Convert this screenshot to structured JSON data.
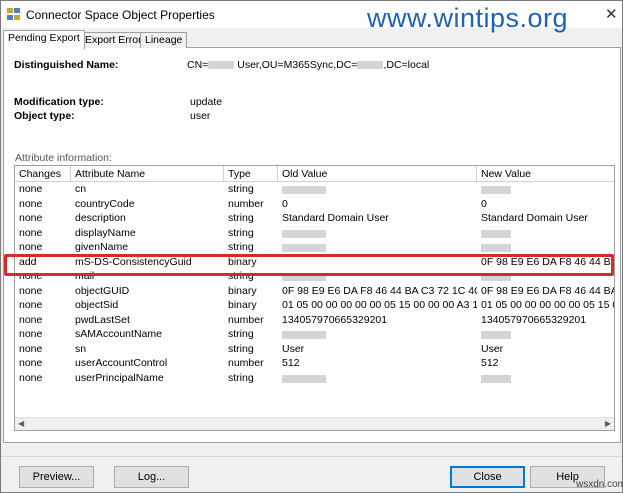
{
  "window": {
    "title": "Connector Space Object Properties",
    "watermark": "www.wintips.org",
    "close_glyph": "✕",
    "footer_mark": "wsxdn.com"
  },
  "tabs": [
    {
      "label": "Pending Export",
      "active": true
    },
    {
      "label": "Export Error",
      "active": false
    },
    {
      "label": "Lineage",
      "active": false
    }
  ],
  "object": {
    "dn_label": "Distinguished Name:",
    "dn_prefix": "CN=",
    "dn_mid": " User,OU=M365Sync,DC=",
    "dn_suffix": ",DC=local",
    "mod_label": "Modification type:",
    "mod_value": "update",
    "type_label": "Object type:",
    "type_value": "user"
  },
  "attributes": {
    "section_label": "Attribute information:",
    "columns": [
      "Changes",
      "Attribute Name",
      "Type",
      "Old Value",
      "New Value"
    ],
    "rows": [
      {
        "change": "none",
        "name": "cn",
        "type": "string",
        "old": "",
        "new": "",
        "old_redacted": true,
        "new_redacted": true
      },
      {
        "change": "none",
        "name": "countryCode",
        "type": "number",
        "old": "0",
        "new": "0"
      },
      {
        "change": "none",
        "name": "description",
        "type": "string",
        "old": "Standard Domain User",
        "new": "Standard Domain User"
      },
      {
        "change": "none",
        "name": "displayName",
        "type": "string",
        "old": "",
        "new": "",
        "old_redacted": true,
        "new_redacted": true
      },
      {
        "change": "none",
        "name": "givenName",
        "type": "string",
        "old": "",
        "new": "",
        "old_redacted": true,
        "new_redacted": true
      },
      {
        "change": "add",
        "name": "mS-DS-ConsistencyGuid",
        "type": "binary",
        "old": "",
        "new": "0F 98 E9 E6 DA F8 46 44 BA C"
      },
      {
        "change": "none",
        "name": "mail",
        "type": "string",
        "old": "",
        "new": "",
        "old_redacted": true,
        "new_redacted": true
      },
      {
        "change": "none",
        "name": "objectGUID",
        "type": "binary",
        "old": "0F 98 E9 E6 DA F8 46 44 BA C3 72 1C 4C...",
        "new": "0F 98 E9 E6 DA F8 46 44 BA C"
      },
      {
        "change": "none",
        "name": "objectSid",
        "type": "binary",
        "old": "01 05 00 00 00 00 00 05 15 00 00 00 A3 1...",
        "new": "01 05 00 00 00 00 00 05 15 00"
      },
      {
        "change": "none",
        "name": "pwdLastSet",
        "type": "number",
        "old": "134057970665329201",
        "new": "134057970665329201"
      },
      {
        "change": "none",
        "name": "sAMAccountName",
        "type": "string",
        "old": "",
        "new": "",
        "old_redacted": true,
        "new_redacted": true
      },
      {
        "change": "none",
        "name": "sn",
        "type": "string",
        "old": "User",
        "new": "User"
      },
      {
        "change": "none",
        "name": "userAccountControl",
        "type": "number",
        "old": "512",
        "new": "512"
      },
      {
        "change": "none",
        "name": "userPrincipalName",
        "type": "string",
        "old": "",
        "new": "",
        "old_redacted": true,
        "new_redacted": true
      }
    ]
  },
  "buttons": {
    "preview": "Preview...",
    "log": "Log...",
    "close": "Close",
    "help": "Help"
  },
  "colors": {
    "highlight": "#d62b2b",
    "watermark": "#1f62b5"
  }
}
